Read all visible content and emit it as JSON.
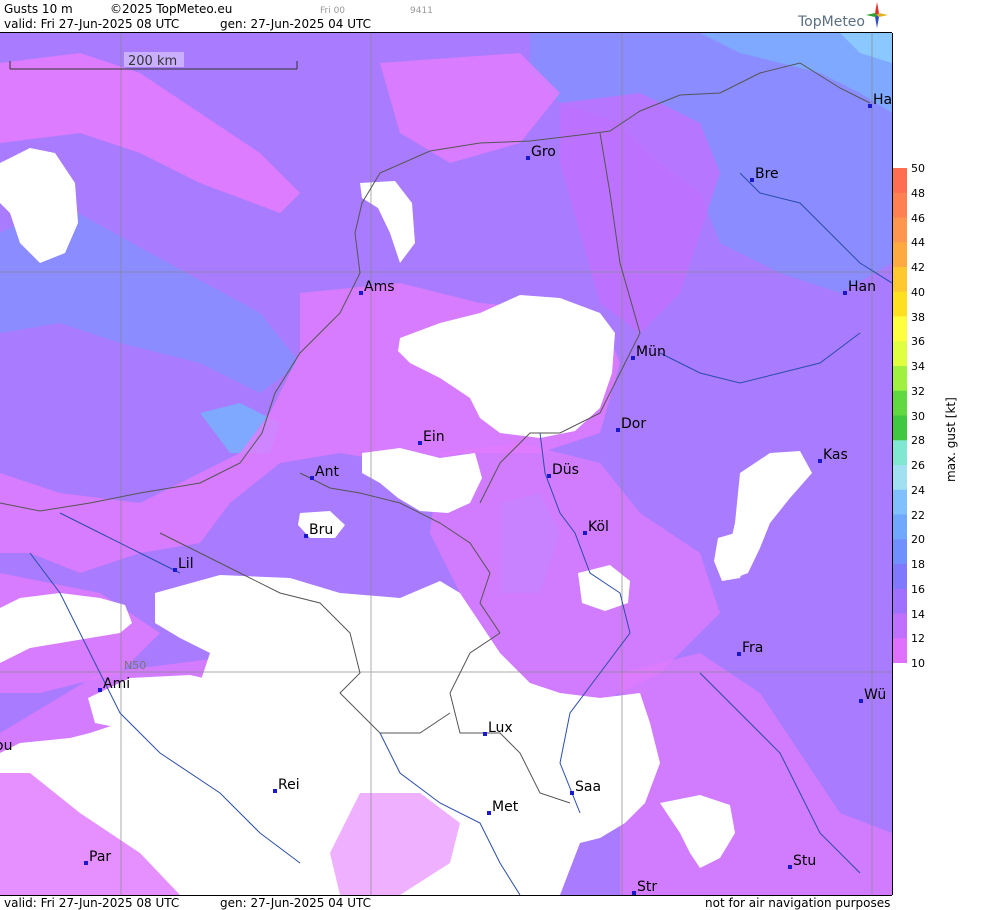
{
  "header": {
    "product": "Gusts 10 m",
    "copyright": "©2025 TopMeteo.eu",
    "time_code": "Fri 00",
    "code": "9411",
    "valid": "valid:  Fri  27-Jun-2025  08 UTC",
    "gen": "gen:  27-Jun-2025  04 UTC",
    "brand": "TopMeteo"
  },
  "footer": {
    "valid": "valid:  Fri  27-Jun-2025  08 UTC",
    "gen": "gen:  27-Jun-2025  04 UTC",
    "disclaimer": "not for air navigation purposes"
  },
  "map": {
    "scale_label": "200 km",
    "lat_label": "N50",
    "cities": [
      {
        "name": "Gro"
      },
      {
        "name": "Bre"
      },
      {
        "name": "Ha"
      },
      {
        "name": "Ams"
      },
      {
        "name": "Han"
      },
      {
        "name": "Mün"
      },
      {
        "name": "Dor"
      },
      {
        "name": "Ein"
      },
      {
        "name": "Düs"
      },
      {
        "name": "Kas"
      },
      {
        "name": "Ant"
      },
      {
        "name": "Bru"
      },
      {
        "name": "Köl"
      },
      {
        "name": "Lil"
      },
      {
        "name": "Fra"
      },
      {
        "name": "Ami"
      },
      {
        "name": "Wü"
      },
      {
        "name": "Lux"
      },
      {
        "name": "Rei"
      },
      {
        "name": "Saa"
      },
      {
        "name": "Met"
      },
      {
        "name": "Par"
      },
      {
        "name": "Stu"
      },
      {
        "name": "Str"
      },
      {
        "name": "ou"
      }
    ]
  },
  "legend": {
    "title": "max. gust [kt]",
    "ticks": [
      "50",
      "48",
      "46",
      "44",
      "42",
      "40",
      "38",
      "36",
      "34",
      "32",
      "30",
      "28",
      "26",
      "24",
      "22",
      "20",
      "18",
      "16",
      "14",
      "12",
      "10"
    ],
    "colors": [
      "#ff6e50",
      "#ff8050",
      "#ff9650",
      "#ffaa40",
      "#ffc830",
      "#ffe020",
      "#ffff40",
      "#e0ff40",
      "#a0f040",
      "#60d840",
      "#40c840",
      "#80e8d0",
      "#a0e0f0",
      "#80c0ff",
      "#70a8ff",
      "#7090ff",
      "#8078ff",
      "#a070ff",
      "#c070ff",
      "#e070ff"
    ]
  },
  "colors": {
    "purple": "#a97bff",
    "magenta": "#e27cff",
    "blue": "#8a8cff",
    "lightblue": "#7fa8ff",
    "city_dot": "#1a1acc"
  }
}
